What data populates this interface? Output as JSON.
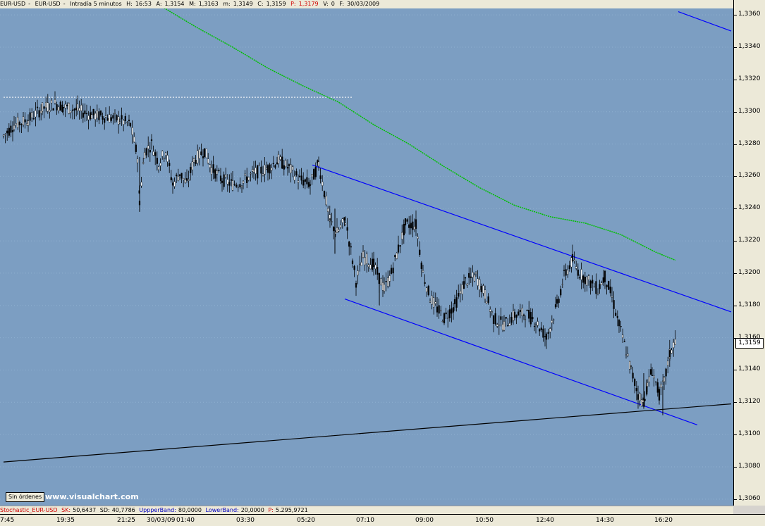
{
  "header": {
    "symbol": "EUR-USD",
    "symbol2": "EUR-USD",
    "interval": "Intradía 5 minutos",
    "h_label": "H:",
    "h_value": "16:53",
    "a_label": "A:",
    "a_value": "1,3154",
    "m_label": "M:",
    "m_value": "1,3163",
    "min_label": "m:",
    "min_value": "1,3149",
    "c_label": "C:",
    "c_value": "1,3159",
    "p_label": "P:",
    "p_value": "1,3179",
    "v_label": "V:",
    "v_value": "0",
    "f_label": "F:",
    "f_value": "30/03/2009"
  },
  "indicator": {
    "name": "Stochastic_EUR-USD",
    "sk_label": "SK:",
    "sk_value": "50,6437",
    "sd_label": "SD:",
    "sd_value": "40,7786",
    "upper_label": "UppperBand:",
    "upper_value": "80,0000",
    "lower_label": "LowerBand:",
    "lower_value": "20,0000",
    "p_label": "P:",
    "p_value": "5.295,9721"
  },
  "footer": {
    "orders_label": "Sin órdenes",
    "brand": "www.visualchart.com"
  },
  "price_badge": "1,3159",
  "colors": {
    "plot_bg": "#7c9ec2",
    "candles": "#000000",
    "ma_line": "#00c000",
    "channel": "#0000ff",
    "support": "#000000"
  },
  "chart_data": {
    "type": "line",
    "title": "",
    "xlabel": "",
    "ylabel": "",
    "ylim": [
      1.3056,
      1.3364
    ],
    "yticks": [
      "1,3060",
      "1,3080",
      "1,3100",
      "1,3120",
      "1,3140",
      "1,3160",
      "1,3180",
      "1,3200",
      "1,3220",
      "1,3240",
      "1,3260",
      "1,3280",
      "1,3300",
      "1,3320",
      "1,3340",
      "1,3360"
    ],
    "ytick_values": [
      1.306,
      1.308,
      1.31,
      1.312,
      1.314,
      1.316,
      1.318,
      1.32,
      1.322,
      1.324,
      1.326,
      1.328,
      1.33,
      1.332,
      1.334,
      1.336
    ],
    "xticks": [
      "7:45",
      "19:35",
      "21:25",
      "30/03/09",
      "01:40",
      "03:30",
      "05:20",
      "07:10",
      "09:00",
      "10:50",
      "12:40",
      "14:30",
      "16:20"
    ],
    "xlim": [
      0,
      1040
    ],
    "xtick_positions": [
      0,
      92,
      178,
      220,
      262,
      347,
      433,
      517,
      601,
      686,
      772,
      857,
      940
    ],
    "price_series": {
      "name": "EUR-USD",
      "x": [
        5,
        20,
        40,
        60,
        78,
        90,
        110,
        130,
        150,
        170,
        185,
        195,
        198,
        205,
        215,
        225,
        235,
        245,
        255,
        265,
        275,
        290,
        300,
        315,
        330,
        345,
        360,
        380,
        395,
        410,
        425,
        440,
        452,
        460,
        468,
        478,
        490,
        500,
        505,
        515,
        530,
        545,
        555,
        565,
        575,
        590,
        600,
        610,
        620,
        630,
        645,
        660,
        675,
        690,
        700,
        715,
        730,
        745,
        760,
        775,
        790,
        800,
        812,
        822,
        835,
        848,
        858,
        868,
        878,
        888,
        895,
        905,
        912,
        918,
        925,
        935,
        942,
        950,
        958
      ],
      "y": [
        1.3285,
        1.3292,
        1.3295,
        1.3302,
        1.3305,
        1.3303,
        1.3301,
        1.3298,
        1.3297,
        1.3295,
        1.3292,
        1.3272,
        1.3245,
        1.3275,
        1.328,
        1.3268,
        1.3276,
        1.3255,
        1.3262,
        1.3255,
        1.327,
        1.3276,
        1.3265,
        1.3258,
        1.3255,
        1.3257,
        1.3262,
        1.3265,
        1.327,
        1.3265,
        1.3258,
        1.3255,
        1.3268,
        1.325,
        1.3232,
        1.3225,
        1.3233,
        1.3208,
        1.3195,
        1.321,
        1.3205,
        1.319,
        1.32,
        1.3215,
        1.323,
        1.323,
        1.32,
        1.3185,
        1.3178,
        1.3172,
        1.318,
        1.3195,
        1.3198,
        1.3185,
        1.3172,
        1.3168,
        1.3174,
        1.3175,
        1.317,
        1.316,
        1.318,
        1.3198,
        1.3208,
        1.32,
        1.3195,
        1.319,
        1.3198,
        1.3185,
        1.3168,
        1.3152,
        1.314,
        1.3125,
        1.312,
        1.313,
        1.314,
        1.3125,
        1.3132,
        1.315,
        1.3159
      ]
    },
    "moving_average": {
      "x": [
        230,
        280,
        330,
        380,
        430,
        480,
        530,
        580,
        630,
        680,
        730,
        780,
        830,
        880,
        930,
        958
      ],
      "y": [
        1.3365,
        1.3352,
        1.334,
        1.3327,
        1.3316,
        1.3306,
        1.3292,
        1.328,
        1.3266,
        1.3253,
        1.3242,
        1.3235,
        1.3231,
        1.3224,
        1.3213,
        1.3208
      ]
    },
    "channel_upper": {
      "x": [
        443,
        1037
      ],
      "y": [
        1.3267,
        1.3176
      ]
    },
    "channel_lower": {
      "x": [
        489,
        989
      ],
      "y": [
        1.3184,
        1.3106
      ]
    },
    "channel_upper_top": {
      "x": [
        962,
        1037
      ],
      "y": [
        1.3362,
        1.335
      ]
    },
    "support_line": {
      "x": [
        5,
        1037
      ],
      "y": [
        1.3083,
        1.3119
      ]
    },
    "reference_line": {
      "x": [
        5,
        500
      ],
      "y": [
        1.3309,
        1.3309
      ]
    }
  }
}
